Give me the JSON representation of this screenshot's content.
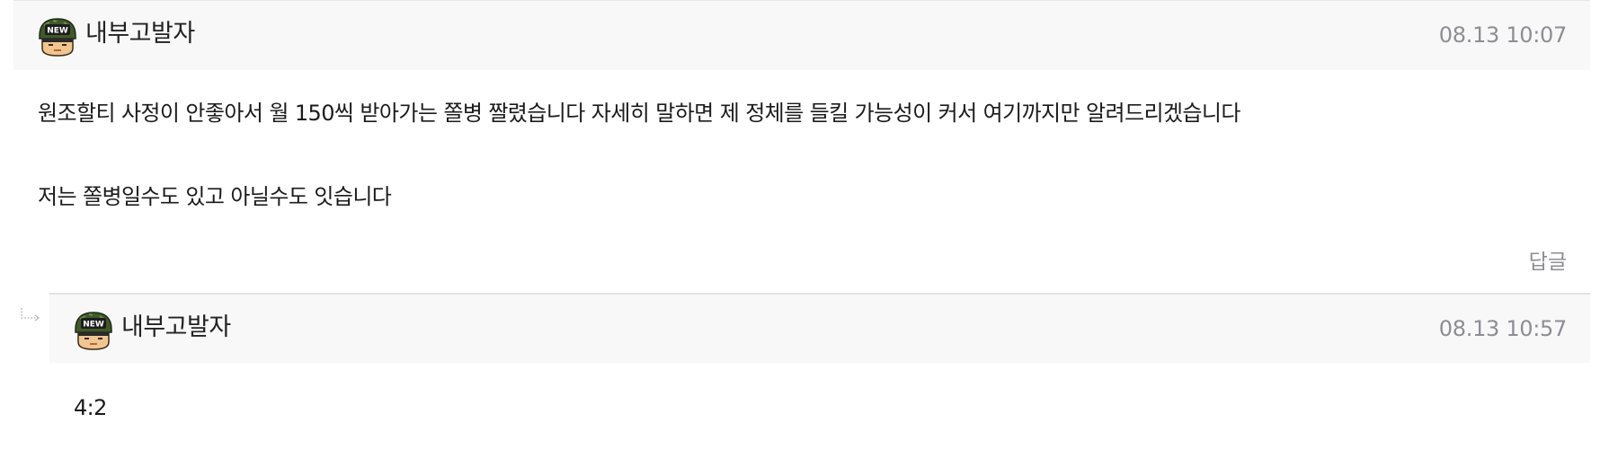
{
  "comments": [
    {
      "nickname": "내부고발자",
      "timestamp": "08.13 10:07",
      "body_lines": [
        "원조할티 사정이 안좋아서 월 150씩 받아가는 쫄병 짤렸습니다 자세히 말하면 제 정체를 들킬 가능성이 커서 여기까지만 알려드리겠습니다",
        "저는 쫄병일수도 있고 아닐수도 잇습니다"
      ],
      "reply_label": "답글",
      "avatar": {
        "icon": "new-soldier-avatar-icon",
        "badge_text": "NEW"
      }
    }
  ],
  "replies": [
    {
      "nickname": "내부고발자",
      "timestamp": "08.13 10:57",
      "body_lines": [
        "4:2"
      ],
      "avatar": {
        "icon": "new-soldier-avatar-icon",
        "badge_text": "NEW"
      },
      "indent_icon": "reply-arrow-icon"
    }
  ],
  "colors": {
    "header_bg": "#f8f8f9",
    "text": "#1b1b1b",
    "muted": "#8d8d93",
    "avatar_helmet": "#3f5a2a",
    "avatar_face": "#f1c58f"
  }
}
